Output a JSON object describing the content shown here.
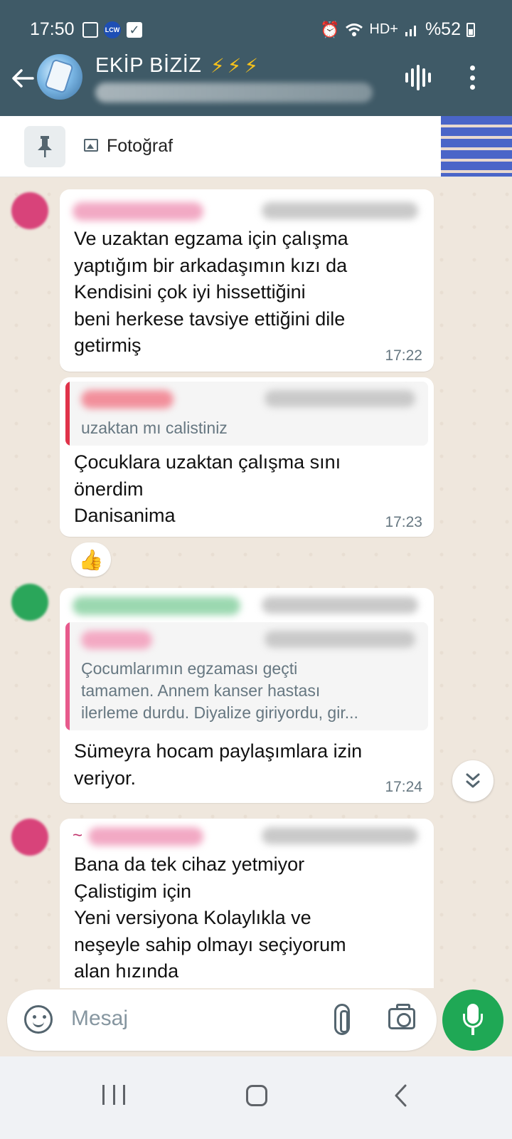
{
  "status_bar": {
    "time": "17:50",
    "lcw": "LCW",
    "network": "HD+",
    "battery": "%52"
  },
  "header": {
    "title": "EKİP BİZİZ",
    "title_emoji": "⚡⚡⚡"
  },
  "pinned": {
    "label": "Fotoğraf"
  },
  "messages": [
    {
      "text": "Ve uzaktan egzama için çalışma\nyaptığım bir arkadaşımın kızı da\nKendisini çok iyi hissettiğini\nbeni herkese tavsiye ettiğini dile\ngetirmiş",
      "time": "17:22"
    },
    {
      "quote": "uzaktan mı calistiniz",
      "text": "Çocuklara uzaktan çalışma sını\nönerdim\nDanisanima",
      "time": "17:23",
      "reaction": "👍"
    },
    {
      "quote": "Çocumlarımın egzaması geçti\ntamamen. Annem kanser hastası\nilerleme durdu. Diyalize giriyordu, gir...",
      "text": "Sümeyra hocam paylaşımlara izin\nveriyor.",
      "time": "17:24"
    },
    {
      "prefix": "~",
      "text": "Bana da tek cihaz yetmiyor\nÇalistigim için\nYeni versiyona Kolaylıkla ve\nneşeyle  sahip olmayı seçiyorum\nalan hızında"
    }
  ],
  "composer": {
    "placeholder": "Mesaj"
  },
  "colors": {
    "header_bg": "#3f5a67",
    "chat_bg": "#efe7dd",
    "accent_green": "#1fa855",
    "timestamp": "#667781"
  }
}
